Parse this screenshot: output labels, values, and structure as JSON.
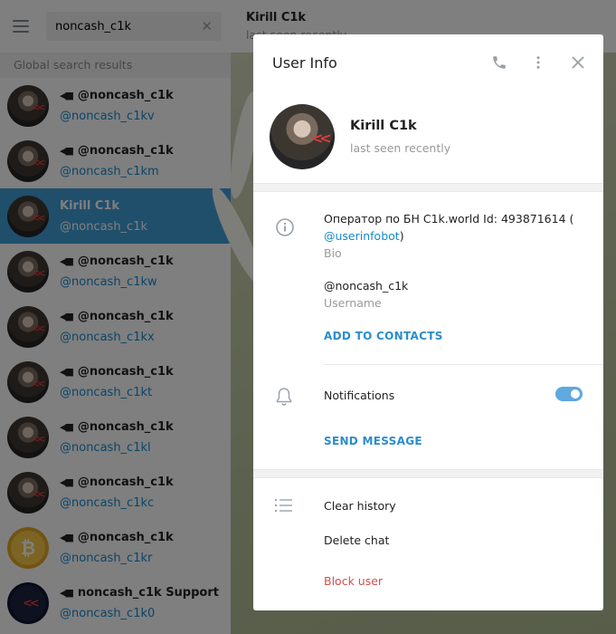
{
  "sidebar": {
    "search": {
      "value": "noncash_c1k"
    },
    "results_header": "Global search results",
    "results": [
      {
        "title": "@noncash_c1k",
        "subtitle": "@noncash_c1kv",
        "is_channel": true,
        "active": false,
        "avatar": "bearded-man"
      },
      {
        "title": "@noncash_c1k",
        "subtitle": "@noncash_c1km",
        "is_channel": true,
        "active": false,
        "avatar": "bearded-man"
      },
      {
        "title": "Kirill C1k",
        "subtitle": "@noncash_c1k",
        "is_channel": false,
        "active": true,
        "avatar": "bearded-man"
      },
      {
        "title": "@noncash_c1k",
        "subtitle": "@noncash_c1kw",
        "is_channel": true,
        "active": false,
        "avatar": "bearded-man"
      },
      {
        "title": "@noncash_c1k",
        "subtitle": "@noncash_c1kx",
        "is_channel": true,
        "active": false,
        "avatar": "bearded-man"
      },
      {
        "title": "@noncash_c1k",
        "subtitle": "@noncash_c1kt",
        "is_channel": true,
        "active": false,
        "avatar": "bearded-man"
      },
      {
        "title": "@noncash_c1k",
        "subtitle": "@noncash_c1kl",
        "is_channel": true,
        "active": false,
        "avatar": "bearded-man"
      },
      {
        "title": "@noncash_c1k",
        "subtitle": "@noncash_c1kc",
        "is_channel": true,
        "active": false,
        "avatar": "bearded-man"
      },
      {
        "title": "@noncash_c1k",
        "subtitle": "@noncash_c1kr",
        "is_channel": true,
        "active": false,
        "avatar": "bitcoin-coin"
      },
      {
        "title": "noncash_c1k Support",
        "subtitle": "@noncash_c1k0",
        "is_channel": true,
        "active": false,
        "avatar": "support-logo"
      }
    ]
  },
  "chat": {
    "title": "Kirill C1k",
    "status": "last seen recently"
  },
  "modal": {
    "title": "User Info",
    "profile": {
      "name": "Kirill C1k",
      "status": "last seen recently"
    },
    "bio": {
      "text": "Оператор по БН C1k.world Id: 493871614 (",
      "link": "@userinfobot",
      "suffix": ")",
      "label": "Bio"
    },
    "username": {
      "value": "@noncash_c1k",
      "label": "Username"
    },
    "add_to_contacts": "ADD TO CONTACTS",
    "notifications": {
      "label": "Notifications",
      "enabled": true
    },
    "send_message": "SEND MESSAGE",
    "menu": {
      "clear_history": "Clear history",
      "delete_chat": "Delete chat",
      "block_user": "Block user"
    }
  },
  "colors": {
    "accent": "#419fd9",
    "link": "#168acd",
    "danger": "#d14e4e",
    "toggle_on": "#5fa8e0"
  }
}
